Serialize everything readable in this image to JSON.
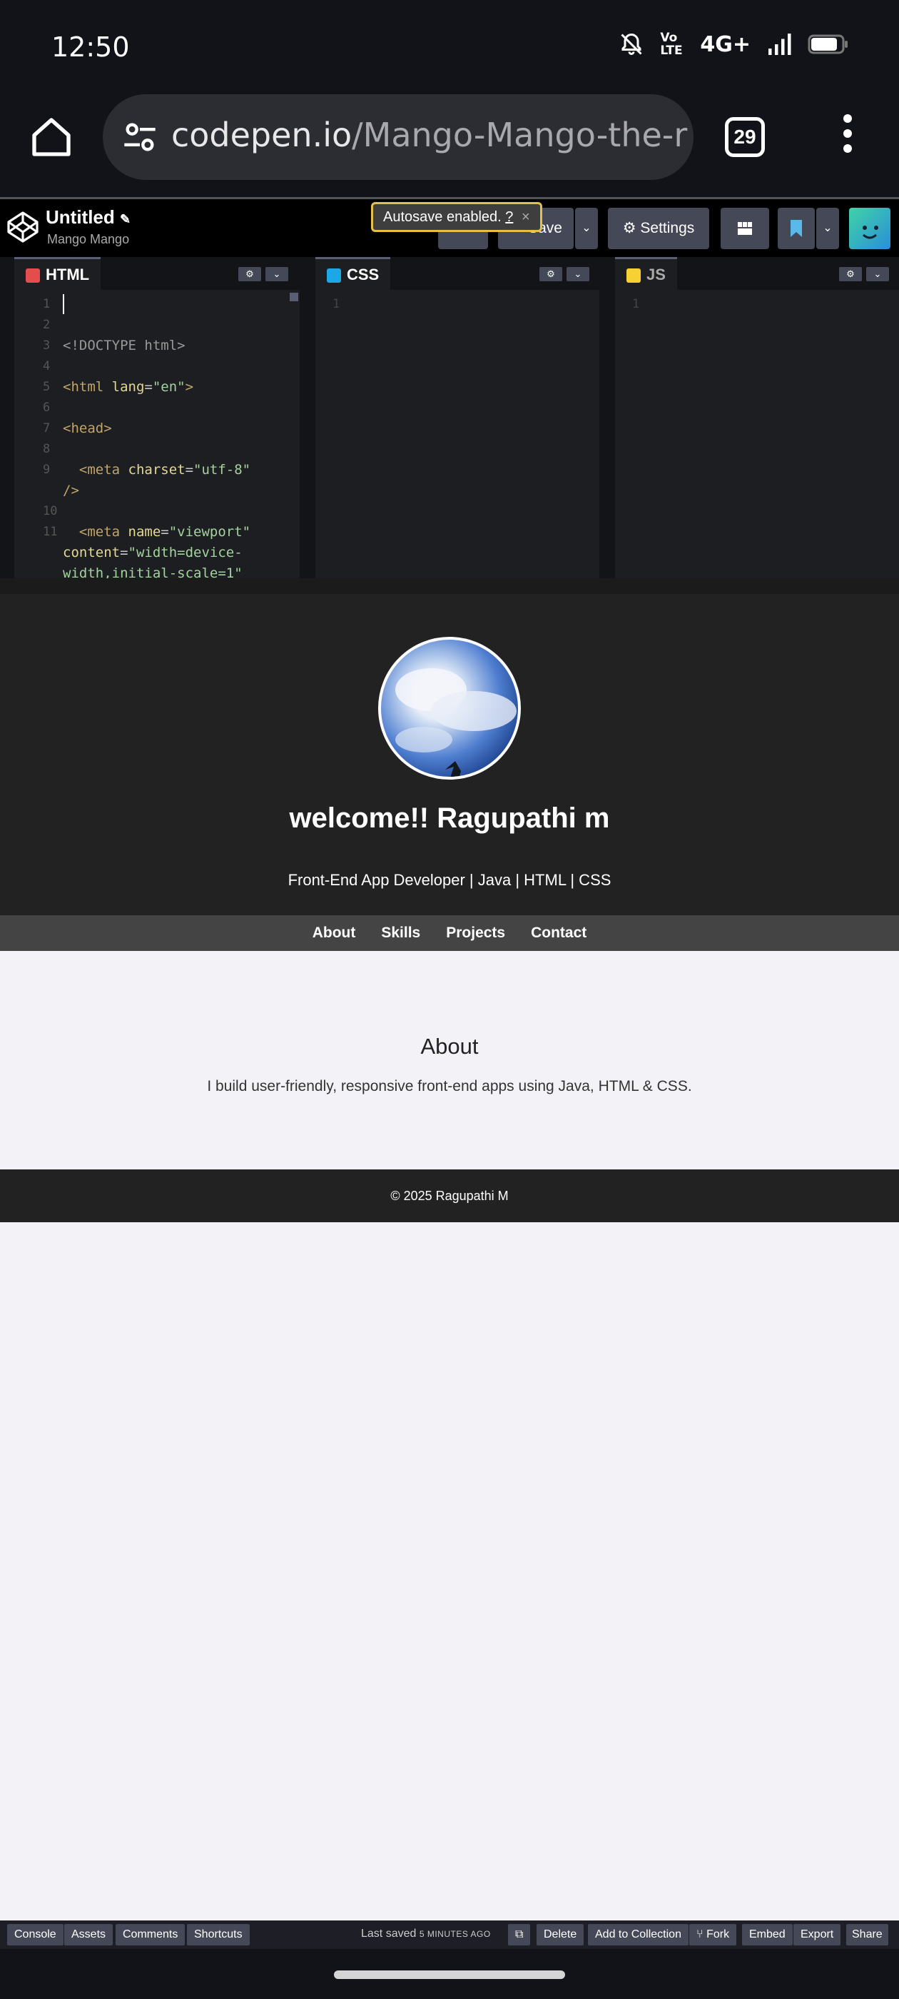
{
  "status_bar": {
    "time": "12:50",
    "network": "4G+",
    "volte": "Vo LTE"
  },
  "browser": {
    "url_domain": "codepen.io",
    "url_path": "/Mango-Mango-the-r",
    "tab_count": "29"
  },
  "codepen": {
    "title": "Untitled",
    "user": "Mango Mango",
    "autosave_msg": "Autosave enabled.",
    "autosave_help": "?",
    "save_label": "Save",
    "settings_label": "Settings"
  },
  "editors": {
    "html_label": "HTML",
    "css_label": "CSS",
    "js_label": "JS",
    "html_lines": [
      "1",
      "2",
      "3",
      "4",
      "5",
      "6",
      "7",
      "8",
      "9",
      "10",
      "11"
    ],
    "css_line": "1",
    "js_line": "1"
  },
  "preview": {
    "hero_title": "welcome!! Ragupathi m",
    "hero_subtitle": "Front-End App Developer | Java | HTML | CSS",
    "nav": [
      "About",
      "Skills",
      "Projects",
      "Contact"
    ],
    "about_heading": "About",
    "about_text": "I build user-friendly, responsive front-end apps using Java, HTML & CSS.",
    "footer": "© 2025 Ragupathi M"
  },
  "bottom_bar": {
    "console": "Console",
    "assets": "Assets",
    "comments": "Comments",
    "shortcuts": "Shortcuts",
    "last_saved_prefix": "Last saved",
    "last_saved_time": "5 MINUTES AGO",
    "delete": "Delete",
    "add_to_collection": "Add to Collection",
    "fork": "Fork",
    "embed": "Embed",
    "export": "Export",
    "share": "Share"
  }
}
